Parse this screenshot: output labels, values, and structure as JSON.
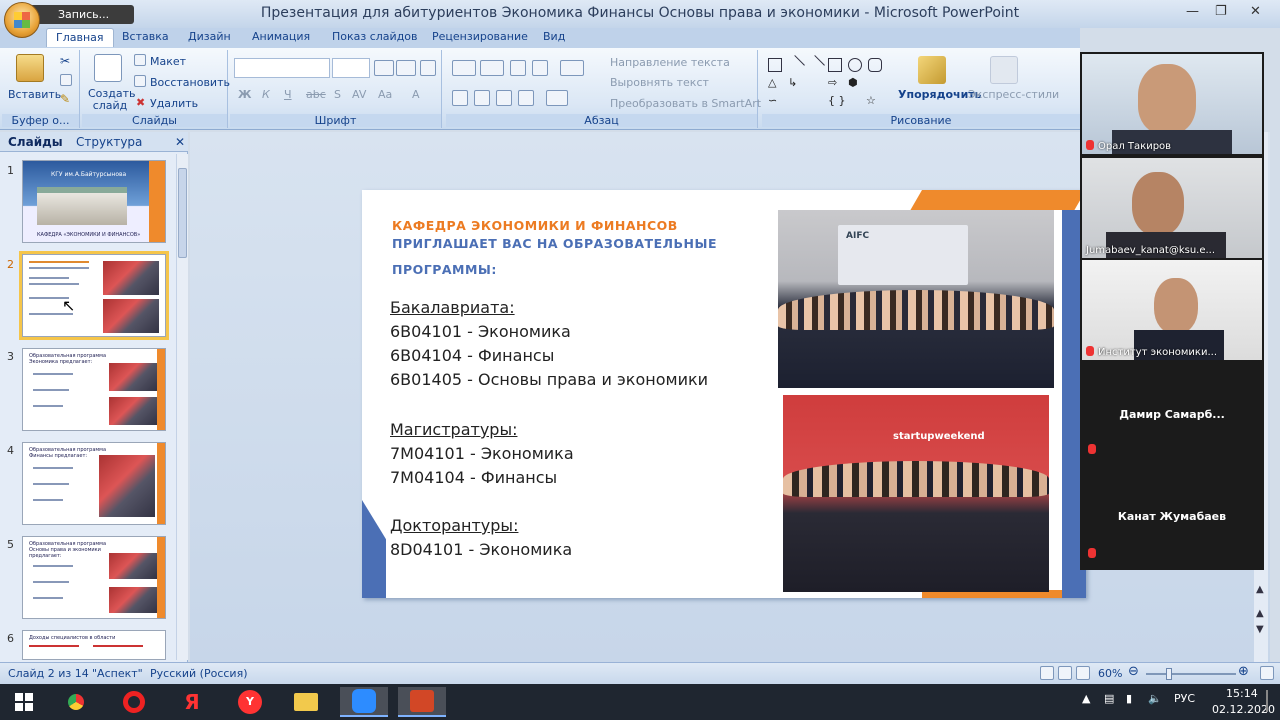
{
  "window": {
    "title": "Презентация для абитуриентов Экономика Финансы Основы права и экономики - Microsoft PowerPoint",
    "recording_label": "Запись..."
  },
  "ribbon": {
    "tabs": [
      "Главная",
      "Вставка",
      "Дизайн",
      "Анимация",
      "Показ слайдов",
      "Рецензирование",
      "Вид"
    ],
    "clipboard": {
      "paste": "Вставить",
      "group": "Буфер о..."
    },
    "slides": {
      "new_slide": "Создать слайд",
      "layout": "Макет",
      "reset": "Восстановить",
      "delete": "Удалить",
      "group": "Слайды"
    },
    "font": {
      "group": "Шрифт"
    },
    "paragraph": {
      "text_direction": "Направление текста",
      "align_text": "Выровнять текст",
      "smartart": "Преобразовать в SmartArt",
      "group": "Абзац"
    },
    "drawing": {
      "arrange": "Упорядочить",
      "quick_styles": "Экспресс-стили",
      "group": "Рисование"
    }
  },
  "left_pane": {
    "tabs": [
      "Слайды",
      "Структура"
    ],
    "thumbnails": [
      {
        "num": "1",
        "title": "КГУ им.А.Байтурсынова",
        "caption": "КАФЕДРА «ЭКОНОМИКИ И ФИНАНСОВ»"
      },
      {
        "num": "2"
      },
      {
        "num": "3",
        "title": "Образовательная программа Экономика предлагает:"
      },
      {
        "num": "4",
        "title": "Образовательная программа Финансы предлагает:"
      },
      {
        "num": "5",
        "title": "Образовательная программа Основы права и экономики предлагает:"
      },
      {
        "num": "6",
        "title": "Доходы специалистов в области"
      }
    ]
  },
  "slide": {
    "heading_line1": "КАФЕДРА ЭКОНОМИКИ И ФИНАНСОВ",
    "heading_line2": "ПРИГЛАШАЕТ ВАС НА ОБРАЗОВАТЕЛЬНЫЕ",
    "heading_line3": "ПРОГРАММЫ:",
    "bachelor_header": "Бакалавриата:",
    "bachelor": [
      "6В04101 - Экономика",
      "6В04104 - Финансы",
      "6В01405 - Основы права и экономики"
    ],
    "master_header": "Магистратуры:",
    "master": [
      "7М04101 - Экономика",
      "7М04104 - Финансы"
    ],
    "doctor_header": "Докторантуры:",
    "doctor": [
      "8D04101 - Экономика"
    ],
    "photo1_banner": "AIFC",
    "photo2_banner": "startupweekend"
  },
  "video": {
    "participants": [
      {
        "name": "Орал Такиров"
      },
      {
        "name": "Jumabaev_kanat@ksu.e..."
      },
      {
        "name": "Институт экономики..."
      },
      {
        "name": "Дамир  Самарб..."
      },
      {
        "name": "Канат Жумабаев"
      }
    ]
  },
  "status": {
    "slide_info": "Слайд 2 из 14",
    "theme": "\"Аспект\"",
    "language": "Русский (Россия)",
    "zoom": "60%"
  },
  "taskbar": {
    "lang": "РУС",
    "time": "15:14",
    "date": "02.12.2020"
  },
  "colors": {
    "accent_orange": "#ef8a2c",
    "accent_blue": "#4b6fb5",
    "ribbon": "#dbe7f5"
  }
}
